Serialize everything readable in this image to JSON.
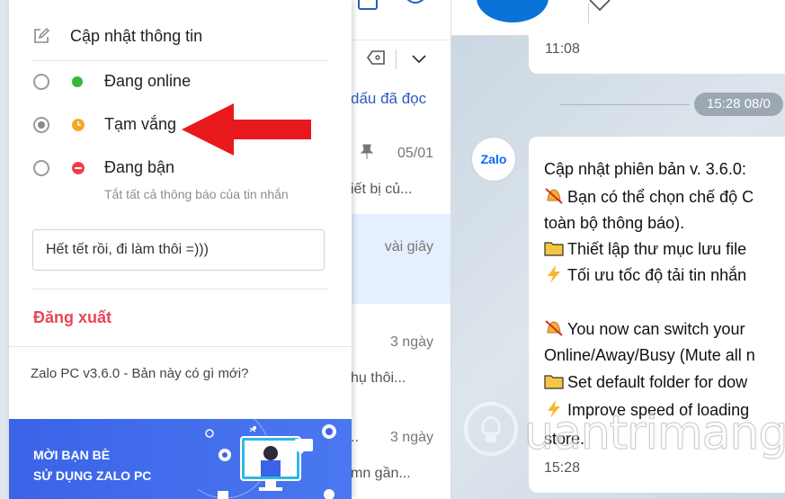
{
  "menu": {
    "update_info_label": "Cập nhật thông tin",
    "statuses": [
      {
        "label": "Đang online",
        "dot_color": "#36b83a",
        "selected": false
      },
      {
        "label": "Tạm vắng",
        "dot_color": "#f5a623",
        "selected": true
      },
      {
        "label": "Đang bận",
        "dot_color": "#ef3b4c",
        "selected": false,
        "sublabel": "Tắt tất cả thông báo của tin nhắn"
      }
    ],
    "status_message_value": "Hết tết rồi, đi làm thôi =)))",
    "logout_label": "Đăng xuất",
    "version_text": "Zalo PC v3.6.0 - Bản này có gì mới?",
    "banner": {
      "line1": "MỜI BẠN BÈ",
      "line2": "SỬ DỤNG ZALO PC"
    }
  },
  "conversation_list": {
    "mark_read_label": "dấu đã đọc",
    "items": [
      {
        "time": "05/01",
        "snippet": "iết bị củ...",
        "pinned": true,
        "selected": false
      },
      {
        "time": "vài giây",
        "snippet": "",
        "pinned": false,
        "selected": true
      },
      {
        "time": "3 ngày",
        "snippet": "hụ thôi...",
        "pinned": false,
        "selected": false
      },
      {
        "time": "3 ngày",
        "snippet": "mn gần...",
        "prefix": "..",
        "pinned": false,
        "selected": false
      }
    ]
  },
  "chat": {
    "first_bubble_time": "11:08",
    "date_pill": "15:28 08/0",
    "avatar_label": "Zalo",
    "message_lines": [
      {
        "icon": "",
        "text": "Cập nhật phiên bản v. 3.6.0:"
      },
      {
        "icon": "muted-bell-icon",
        "text": "Bạn có thể chọn chế độ C"
      },
      {
        "icon": "",
        "text": "toàn bộ thông báo)."
      },
      {
        "icon": "folder-icon",
        "text": "Thiết lập thư mục lưu file"
      },
      {
        "icon": "lightning-icon",
        "text": "Tối ưu tốc độ tải tin nhắn"
      },
      {
        "icon": "muted-bell-icon",
        "text": "You now can switch your"
      },
      {
        "icon": "",
        "text": "Online/Away/Busy (Mute all n"
      },
      {
        "icon": "folder-icon",
        "text": "Set default folder for dow"
      },
      {
        "icon": "lightning-icon",
        "text": "Improve speed of loading"
      },
      {
        "icon": "",
        "text": "store."
      }
    ],
    "message_time": "15:28"
  },
  "watermark_text": "uantrimang",
  "colors": {
    "accent_blue": "#0a73d8",
    "logout_red": "#e8475a",
    "banner_blue": "#3a63e8",
    "arrow_red": "#e8191c"
  }
}
